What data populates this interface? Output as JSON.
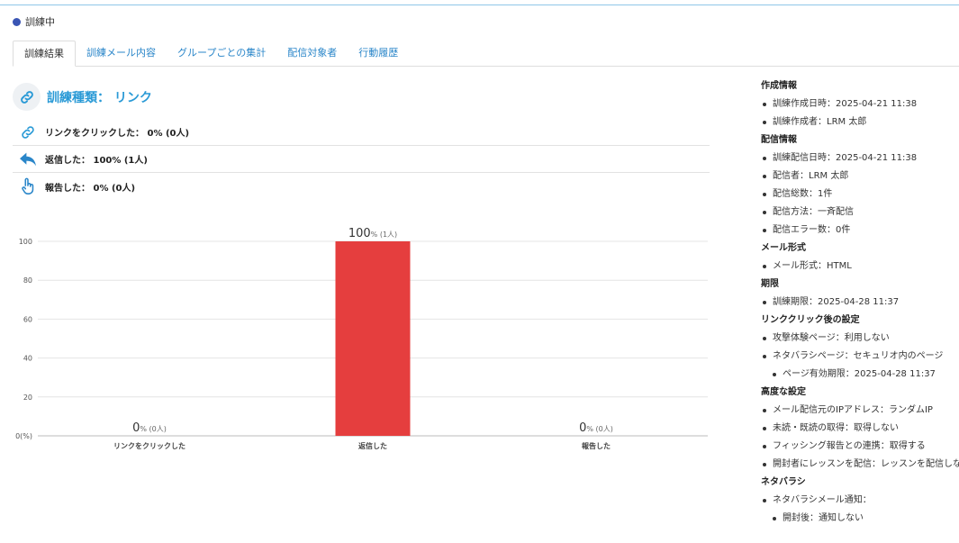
{
  "status": {
    "label": "訓練中",
    "color": "#3a55b4"
  },
  "tabs": [
    {
      "label": "訓練結果",
      "active": true
    },
    {
      "label": "訓練メール内容",
      "active": false
    },
    {
      "label": "グループごとの集計",
      "active": false
    },
    {
      "label": "配信対象者",
      "active": false
    },
    {
      "label": "行動履歴",
      "active": false
    }
  ],
  "training_type": {
    "title": "訓練種類： リンク",
    "icon": "link-icon"
  },
  "stats": [
    {
      "label": "リンクをクリックした： 0% (0人)",
      "icon": "link-icon"
    },
    {
      "label": "返信した： 100% (1人)",
      "icon": "reply-icon"
    },
    {
      "label": "報告した： 0% (0人)",
      "icon": "report-icon"
    }
  ],
  "chart_data": {
    "type": "bar",
    "categories": [
      "リンクをクリックした",
      "返信した",
      "報告した"
    ],
    "values": [
      0,
      100,
      0
    ],
    "data_labels": [
      {
        "value": "0",
        "suffix": "% (0人)"
      },
      {
        "value": "100",
        "suffix": "% (1人)"
      },
      {
        "value": "0",
        "suffix": "% (0人)"
      }
    ],
    "yticks": [
      "0(%)",
      "20",
      "40",
      "60",
      "80",
      "100"
    ],
    "ylim": [
      0,
      100
    ],
    "bar_color": "#e53e3e",
    "grid": true
  },
  "sidebar": {
    "sections": [
      {
        "title": "作成情報",
        "items": [
          {
            "text": "訓練作成日時：2025-04-21 11:38",
            "sub": false
          },
          {
            "text": "訓練作成者：LRM 太郎",
            "sub": false
          }
        ]
      },
      {
        "title": "配信情報",
        "items": [
          {
            "text": "訓練配信日時：2025-04-21 11:38",
            "sub": false
          },
          {
            "text": "配信者：LRM 太郎",
            "sub": false
          },
          {
            "text": "配信総数：1件",
            "sub": false
          },
          {
            "text": "配信方法：一斉配信",
            "sub": false
          },
          {
            "text": "配信エラー数：0件",
            "sub": false
          }
        ]
      },
      {
        "title": "メール形式",
        "items": [
          {
            "text": "メール形式：HTML",
            "sub": false
          }
        ]
      },
      {
        "title": "期限",
        "items": [
          {
            "text": "訓練期限：2025-04-28 11:37",
            "sub": false
          }
        ]
      },
      {
        "title": "リンククリック後の設定",
        "items": [
          {
            "text": "攻撃体験ページ：利用しない",
            "sub": false
          },
          {
            "text": "ネタバラシページ：セキュリオ内のページ",
            "sub": false
          },
          {
            "text": "ページ有効期限：2025-04-28 11:37",
            "sub": true
          }
        ]
      },
      {
        "title": "高度な設定",
        "items": [
          {
            "text": "メール配信元のIPアドレス：ランダムIP",
            "sub": false
          },
          {
            "text": "未読・既読の取得：取得しない",
            "sub": false
          },
          {
            "text": "フィッシング報告との連携：取得する",
            "sub": false
          },
          {
            "text": "開封者にレッスンを配信：レッスンを配信しない",
            "sub": false
          }
        ]
      },
      {
        "title": "ネタバラシ",
        "items": [
          {
            "text": "ネタバラシメール通知：",
            "sub": false
          },
          {
            "text": "開封後：通知しない",
            "sub": true
          }
        ]
      }
    ]
  }
}
